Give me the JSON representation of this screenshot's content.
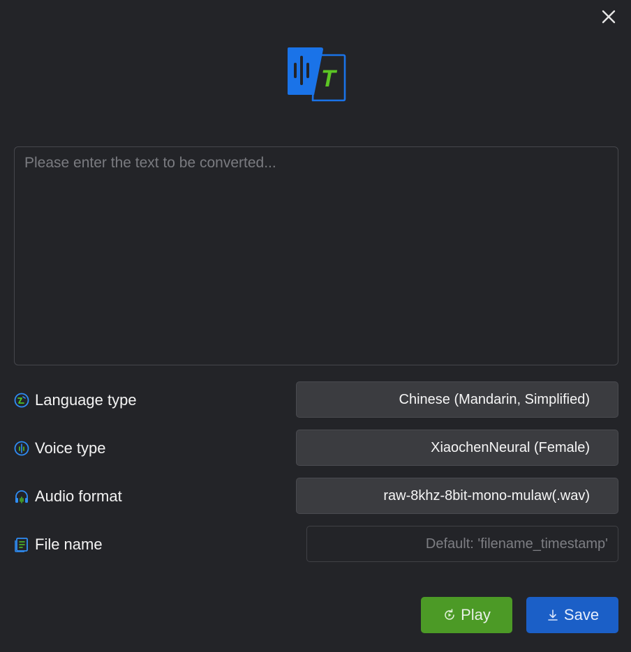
{
  "dialog": {
    "close_icon": "close-icon",
    "logo_icon": "speech-to-text-logo-icon",
    "logo_letter": "T"
  },
  "text_input": {
    "placeholder": "Please enter the text to be converted...",
    "value": ""
  },
  "settings": {
    "language": {
      "label": "Language type",
      "icon": "language-icon",
      "value": "Chinese (Mandarin, Simplified)"
    },
    "voice": {
      "label": "Voice type",
      "icon": "voice-icon",
      "value": "XiaochenNeural (Female)"
    },
    "audio_format": {
      "label": "Audio format",
      "icon": "headphones-icon",
      "value": "raw-8khz-8bit-mono-mulaw(.wav)"
    },
    "file_name": {
      "label": "File name",
      "icon": "file-icon",
      "placeholder": "Default: 'filename_timestamp'",
      "value": ""
    }
  },
  "actions": {
    "play_label": "Play",
    "play_icon": "play-refresh-icon",
    "save_label": "Save",
    "save_icon": "download-icon"
  },
  "colors": {
    "background": "#232428",
    "play_button": "#4c9a26",
    "save_button": "#1b5fc7",
    "accent_blue": "#1a73e8",
    "accent_green": "#5cc524"
  }
}
